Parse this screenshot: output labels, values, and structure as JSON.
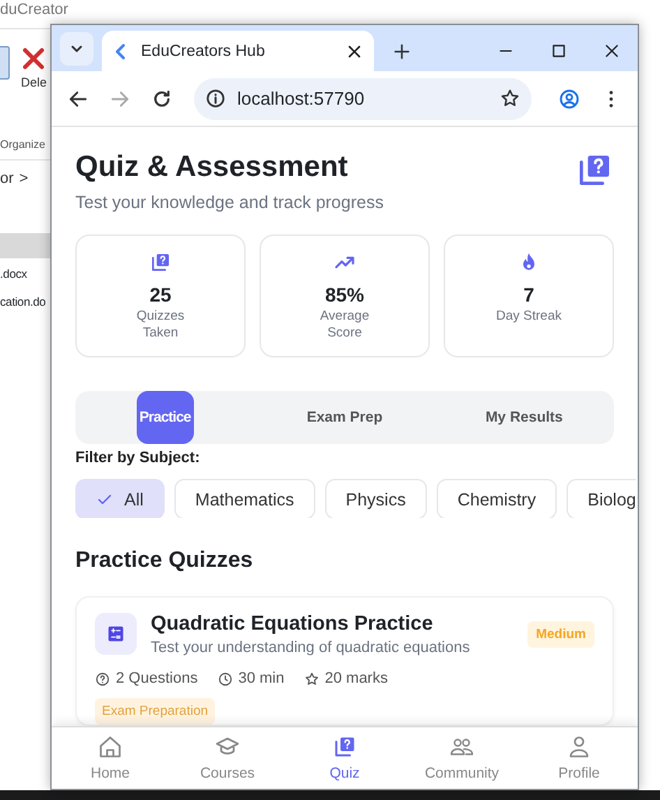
{
  "background_window": {
    "title": "duCreator",
    "ribbon_button": "Dele",
    "group_label": "Organize",
    "breadcrumb": "or",
    "breadcrumb_arrow": ">",
    "files": [
      {
        "selected": true
      },
      {
        "name": ".docx",
        "selected": false
      },
      {
        "name": "cation.do",
        "selected": false
      }
    ]
  },
  "browser": {
    "tab_title": "EduCreators Hub",
    "url": "localhost:57790"
  },
  "page": {
    "title": "Quiz & Assessment",
    "subtitle": "Test your knowledge and track progress",
    "stats": [
      {
        "kind": "quiz",
        "value": "25",
        "label": "Quizzes Taken"
      },
      {
        "kind": "trend",
        "value": "85%",
        "label": "Average Score"
      },
      {
        "kind": "flame",
        "value": "7",
        "label": "Day Streak"
      }
    ],
    "segments": [
      {
        "label": "Practice",
        "selected": true
      },
      {
        "label": "Exam Prep",
        "selected": false
      },
      {
        "label": "My Results",
        "selected": false
      }
    ],
    "filter_label": "Filter by Subject:",
    "chips": [
      {
        "label": "All",
        "selected": true
      },
      {
        "label": "Mathematics",
        "selected": false
      },
      {
        "label": "Physics",
        "selected": false
      },
      {
        "label": "Chemistry",
        "selected": false
      },
      {
        "label": "Biolog",
        "selected": false
      }
    ],
    "section_title": "Practice Quizzes",
    "quizzes": [
      {
        "title": "Quadratic Equations Practice",
        "description": "Test your understanding of quadratic equations",
        "difficulty": "Medium",
        "questions": "2 Questions",
        "duration": "30 min",
        "marks": "20 marks",
        "tag": "Exam Preparation"
      }
    ]
  },
  "bottom_nav": [
    {
      "kind": "home",
      "label": "Home",
      "selected": false
    },
    {
      "kind": "courses",
      "label": "Courses",
      "selected": false
    },
    {
      "kind": "quiz",
      "label": "Quiz",
      "selected": true
    },
    {
      "kind": "community",
      "label": "Community",
      "selected": false
    },
    {
      "kind": "profile",
      "label": "Profile",
      "selected": false
    }
  ]
}
